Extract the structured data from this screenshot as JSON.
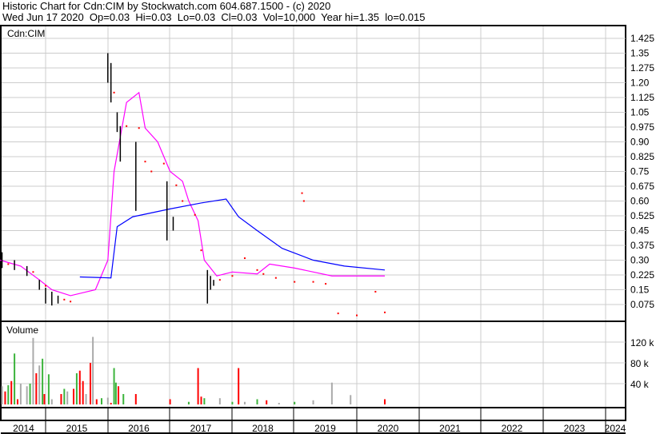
{
  "header": {
    "line1": "Historic Chart for Cdn:CIM by Stockwatch.com 604.687.1500 - (c) 2020",
    "line2": "Wed Jun 17 2020  Op=0.03  Hi=0.03  Lo=0.03  Cl=0.03  Vol=10,000  Year hi=1.35  lo=0.015"
  },
  "chart_data": [
    {
      "type": "line",
      "title": "Cdn:CIM",
      "ylim": [
        0,
        1.5
      ],
      "yticks": [
        "1.425",
        "1.35",
        "1.275",
        "1.20",
        "1.125",
        "1.05",
        "0.975",
        "0.90",
        "0.825",
        "0.75",
        "0.675",
        "0.60",
        "0.525",
        "0.45",
        "0.375",
        "0.30",
        "0.225",
        "0.15",
        "0.075"
      ],
      "colors": {
        "short_ma": "#ff00ff",
        "long_ma": "#0000ff",
        "price": "#000000",
        "dots": "#ff0000"
      },
      "series": [
        {
          "name": "short_ma",
          "points": [
            [
              2014.27,
              0.3
            ],
            [
              2014.6,
              0.27
            ],
            [
              2014.9,
              0.2
            ],
            [
              2015.1,
              0.15
            ],
            [
              2015.4,
              0.12
            ],
            [
              2015.8,
              0.15
            ],
            [
              2016.0,
              0.3
            ],
            [
              2016.1,
              0.75
            ],
            [
              2016.3,
              1.1
            ],
            [
              2016.5,
              1.15
            ],
            [
              2016.6,
              0.97
            ],
            [
              2016.8,
              0.9
            ],
            [
              2017.0,
              0.75
            ],
            [
              2017.2,
              0.7
            ],
            [
              2017.3,
              0.6
            ],
            [
              2017.45,
              0.5
            ],
            [
              2017.55,
              0.3
            ],
            [
              2017.75,
              0.22
            ],
            [
              2018.0,
              0.24
            ],
            [
              2018.4,
              0.23
            ],
            [
              2018.6,
              0.28
            ],
            [
              2019.0,
              0.26
            ],
            [
              2019.6,
              0.22
            ],
            [
              2020.45,
              0.22
            ]
          ]
        },
        {
          "name": "long_ma",
          "points": [
            [
              2015.55,
              0.215
            ],
            [
              2016.05,
              0.21
            ],
            [
              2016.15,
              0.47
            ],
            [
              2016.4,
              0.52
            ],
            [
              2017.0,
              0.56
            ],
            [
              2017.5,
              0.59
            ],
            [
              2017.9,
              0.61
            ],
            [
              2018.1,
              0.52
            ],
            [
              2018.4,
              0.45
            ],
            [
              2018.8,
              0.36
            ],
            [
              2019.3,
              0.3
            ],
            [
              2019.8,
              0.27
            ],
            [
              2020.45,
              0.25
            ]
          ]
        }
      ],
      "price_bars": [
        [
          2014.3,
          0.34,
          0.26
        ],
        [
          2014.5,
          0.3,
          0.25
        ],
        [
          2014.7,
          0.27,
          0.22
        ],
        [
          2014.9,
          0.2,
          0.15
        ],
        [
          2015.0,
          0.16,
          0.08
        ],
        [
          2015.1,
          0.14,
          0.07
        ],
        [
          2015.2,
          0.12,
          0.08
        ],
        [
          2016.0,
          1.35,
          1.2
        ],
        [
          2016.05,
          1.3,
          1.1
        ],
        [
          2016.15,
          1.05,
          0.95
        ],
        [
          2016.2,
          0.98,
          0.8
        ],
        [
          2016.45,
          0.9,
          0.55
        ],
        [
          2016.95,
          0.7,
          0.4
        ],
        [
          2017.05,
          0.52,
          0.45
        ],
        [
          2017.6,
          0.25,
          0.08
        ],
        [
          2017.65,
          0.22,
          0.15
        ],
        [
          2017.7,
          0.2,
          0.17
        ]
      ],
      "dots": [
        [
          2014.4,
          0.28
        ],
        [
          2014.8,
          0.24
        ],
        [
          2015.0,
          0.17
        ],
        [
          2015.3,
          0.1
        ],
        [
          2015.4,
          0.09
        ],
        [
          2016.1,
          1.15
        ],
        [
          2016.3,
          0.98
        ],
        [
          2016.5,
          0.97
        ],
        [
          2016.6,
          0.8
        ],
        [
          2016.7,
          0.75
        ],
        [
          2016.9,
          0.79
        ],
        [
          2017.1,
          0.68
        ],
        [
          2017.2,
          0.6
        ],
        [
          2017.4,
          0.53
        ],
        [
          2017.5,
          0.35
        ],
        [
          2017.8,
          0.2
        ],
        [
          2018.0,
          0.22
        ],
        [
          2018.2,
          0.31
        ],
        [
          2018.4,
          0.25
        ],
        [
          2018.5,
          0.23
        ],
        [
          2018.7,
          0.21
        ],
        [
          2019.0,
          0.19
        ],
        [
          2019.3,
          0.19
        ],
        [
          2019.5,
          0.18
        ],
        [
          2019.7,
          0.03
        ],
        [
          2020.0,
          0.02
        ],
        [
          2020.3,
          0.14
        ],
        [
          2020.45,
          0.035
        ],
        [
          2019.15,
          0.6
        ],
        [
          2019.12,
          0.64
        ]
      ]
    },
    {
      "type": "bar",
      "title": "Volume",
      "ylim": [
        0,
        160000
      ],
      "yticks": [
        "120 k",
        "80 k",
        "40 k"
      ],
      "colors": {
        "up": "#3cb43c",
        "down": "#ff0000",
        "flat": "#aaaaaa"
      },
      "bars": [
        [
          2014.3,
          35000,
          "flat"
        ],
        [
          2014.35,
          25000,
          "down"
        ],
        [
          2014.4,
          37000,
          "up"
        ],
        [
          2014.45,
          45000,
          "down"
        ],
        [
          2014.5,
          98000,
          "up"
        ],
        [
          2014.55,
          10000,
          "down"
        ],
        [
          2014.6,
          40000,
          "flat"
        ],
        [
          2014.7,
          35000,
          "flat"
        ],
        [
          2014.75,
          40000,
          "up"
        ],
        [
          2014.8,
          128000,
          "flat"
        ],
        [
          2014.85,
          60000,
          "down"
        ],
        [
          2014.9,
          75000,
          "flat"
        ],
        [
          2014.95,
          88000,
          "up"
        ],
        [
          2014.98,
          20000,
          "down"
        ],
        [
          2015.05,
          58000,
          "up"
        ],
        [
          2015.1,
          10000,
          "flat"
        ],
        [
          2015.25,
          20000,
          "down"
        ],
        [
          2015.3,
          30000,
          "up"
        ],
        [
          2015.35,
          25000,
          "flat"
        ],
        [
          2015.45,
          30000,
          "down"
        ],
        [
          2015.5,
          60000,
          "up"
        ],
        [
          2015.55,
          65000,
          "down"
        ],
        [
          2015.6,
          45000,
          "down"
        ],
        [
          2015.65,
          20000,
          "flat"
        ],
        [
          2015.72,
          80000,
          "down"
        ],
        [
          2015.76,
          130000,
          "flat"
        ],
        [
          2015.82,
          10000,
          "down"
        ],
        [
          2015.9,
          12000,
          "up"
        ],
        [
          2016.0,
          13000,
          "flat"
        ],
        [
          2016.05,
          3000,
          "down"
        ],
        [
          2016.1,
          70000,
          "up"
        ],
        [
          2016.13,
          42000,
          "up"
        ],
        [
          2016.17,
          35000,
          "down"
        ],
        [
          2016.25,
          20000,
          "up"
        ],
        [
          2016.45,
          20000,
          "down"
        ],
        [
          2017.0,
          10000,
          "down"
        ],
        [
          2017.3,
          5000,
          "up"
        ],
        [
          2017.45,
          70000,
          "down"
        ],
        [
          2017.5,
          15000,
          "down"
        ],
        [
          2017.55,
          12000,
          "up"
        ],
        [
          2017.8,
          12000,
          "flat"
        ],
        [
          2018.0,
          5000,
          "up"
        ],
        [
          2018.1,
          70000,
          "down"
        ],
        [
          2018.2,
          5000,
          "flat"
        ],
        [
          2018.4,
          10000,
          "up"
        ],
        [
          2018.55,
          8000,
          "down"
        ],
        [
          2018.75,
          3000,
          "flat"
        ],
        [
          2019.0,
          5000,
          "up"
        ],
        [
          2019.3,
          8000,
          "flat"
        ],
        [
          2019.6,
          42000,
          "flat"
        ],
        [
          2019.9,
          18000,
          "flat"
        ],
        [
          2020.45,
          10000,
          "down"
        ]
      ]
    }
  ],
  "xaxis": {
    "labels": [
      "2014",
      "2015",
      "2016",
      "2017",
      "2018",
      "2019",
      "2020",
      "2021",
      "2022",
      "2023",
      "2024"
    ]
  }
}
